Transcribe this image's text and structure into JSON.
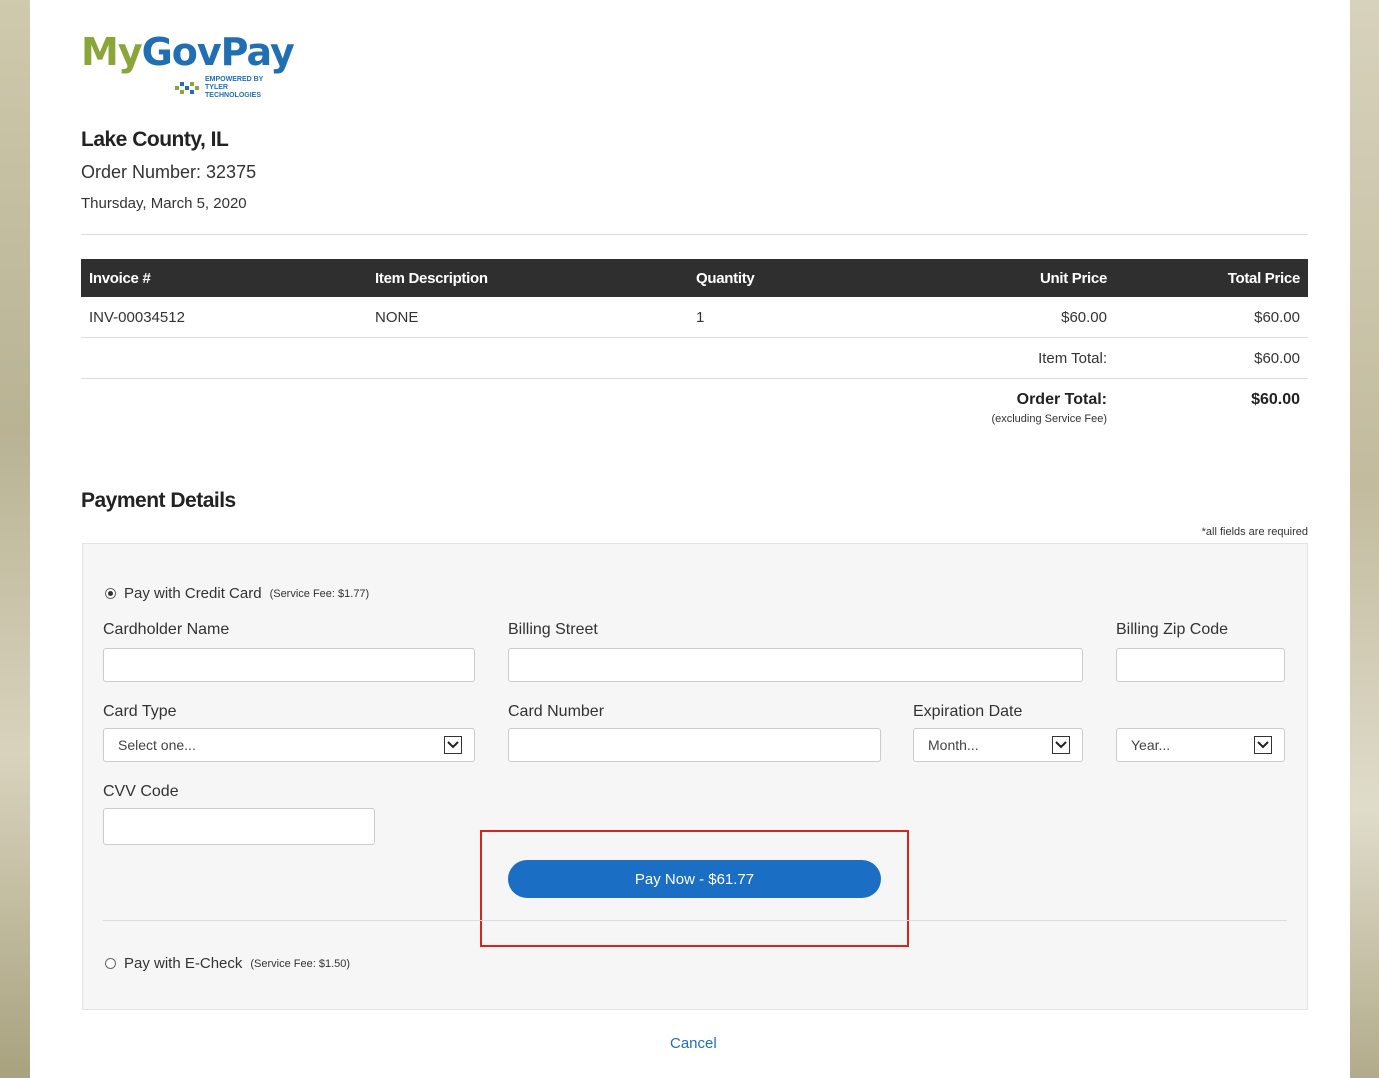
{
  "header": {
    "logo": {
      "my": "My",
      "gov_pay": "GovPay",
      "tagline": "EMPOWERED BY TYLER TECHNOLOGIES"
    },
    "county": "Lake County, IL",
    "order_number": "Order Number: 32375",
    "date": "Thursday, March 5, 2020"
  },
  "invoice_table": {
    "columns": [
      "Invoice #",
      "Item Description",
      "Quantity",
      "Unit Price",
      "Total Price"
    ],
    "rows": [
      {
        "invoice": "INV-00034512",
        "description": "NONE",
        "quantity": "1",
        "unit_price": "$60.00",
        "total_price": "$60.00"
      }
    ],
    "item_total_label": "Item Total:",
    "item_total_value": "$60.00",
    "order_total_label": "Order Total:",
    "order_total_note": "(excluding Service Fee)",
    "order_total_value": "$60.00"
  },
  "payment": {
    "title": "Payment Details",
    "required_note": "*all fields are required",
    "credit_card": {
      "label": "Pay with Credit Card",
      "fee": "(Service Fee: $1.77)",
      "selected": true
    },
    "fields": {
      "cardholder_name": "Cardholder Name",
      "billing_street": "Billing Street",
      "billing_zip": "Billing Zip Code",
      "card_type": "Card Type",
      "card_type_placeholder": "Select one...",
      "card_number": "Card Number",
      "expiration_date": "Expiration Date",
      "month_placeholder": "Month...",
      "year_placeholder": "Year...",
      "cvv_code": "CVV Code"
    },
    "pay_button": "Pay Now - $61.77",
    "echeck": {
      "label": "Pay with E-Check",
      "fee": "(Service Fee: $1.50)",
      "selected": false
    }
  },
  "cancel_link": "Cancel",
  "colors": {
    "primary": "#1a6fc4",
    "highlight": "#d9241e",
    "header_bg": "#2f2f2f",
    "logo_green": "#8aa63a"
  }
}
